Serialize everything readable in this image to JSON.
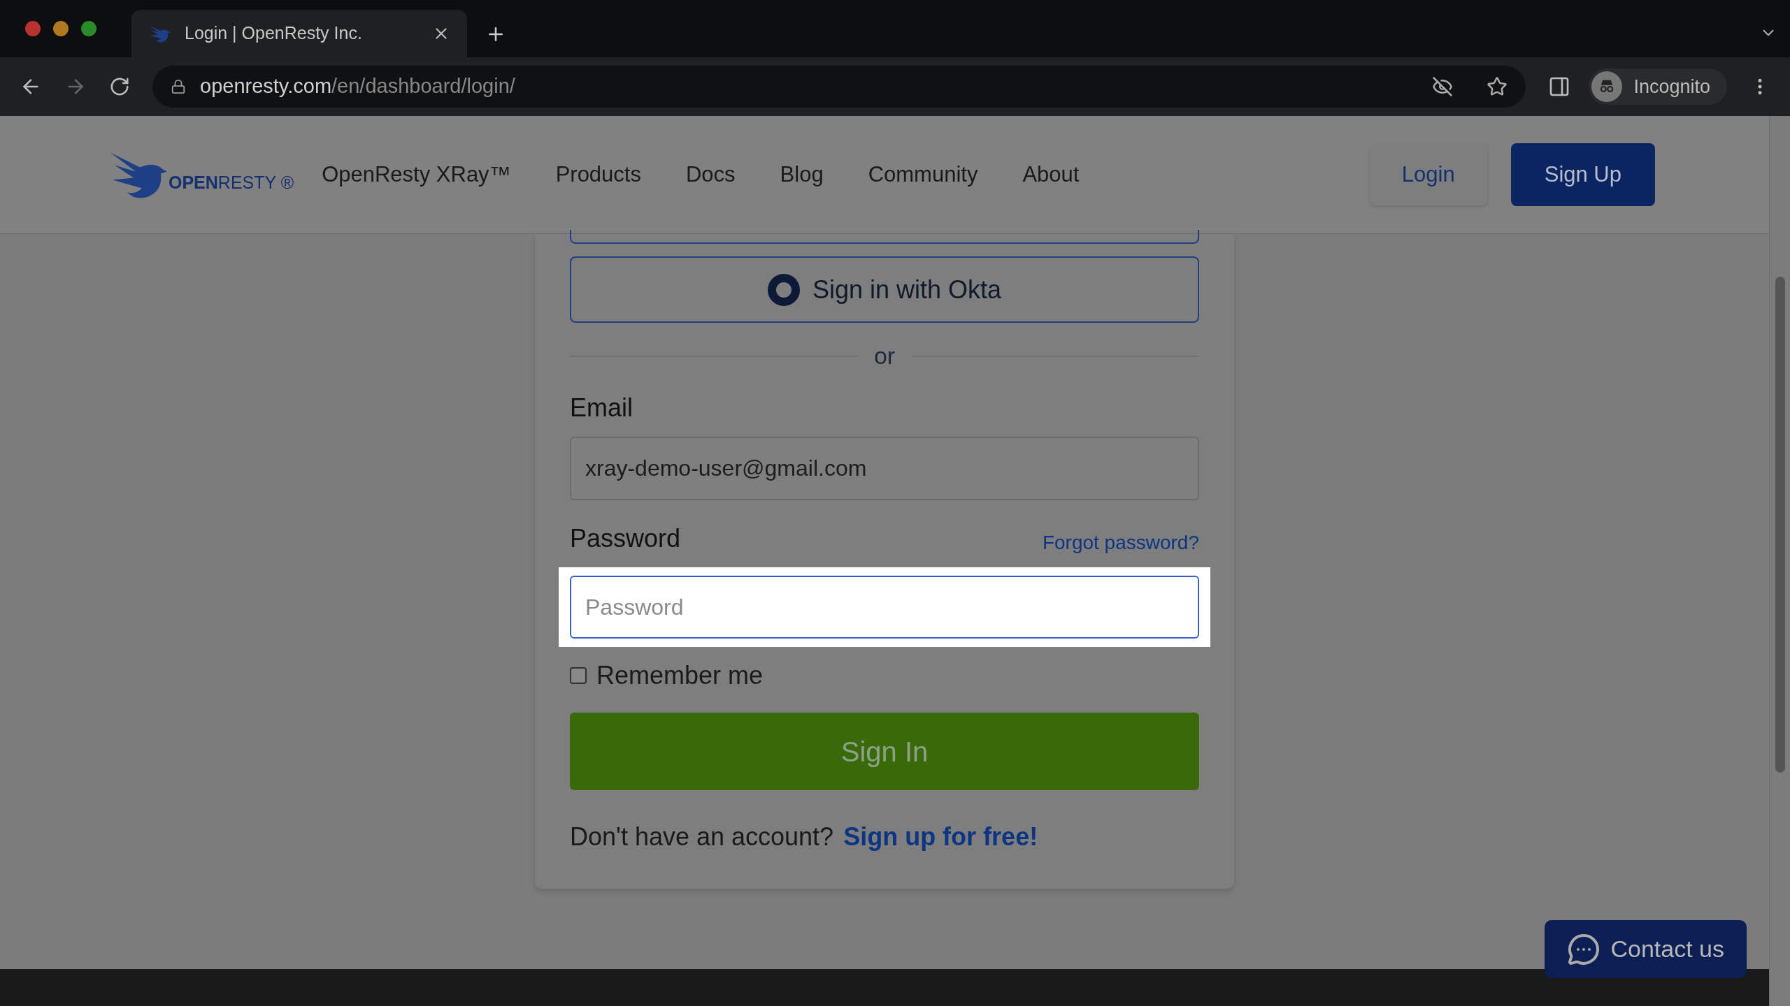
{
  "browser": {
    "tab": {
      "title": "Login | OpenResty Inc."
    },
    "url": {
      "host": "openresty.com",
      "path": "/en/dashboard/login/"
    },
    "profile": "Incognito"
  },
  "nav": {
    "logo": "**OPEN**RESTY ®",
    "items": [
      "OpenResty XRay™",
      "Products",
      "Docs",
      "Blog",
      "Community",
      "About"
    ],
    "login": "Login",
    "signup": "Sign Up"
  },
  "form": {
    "okta": "Sign in with Okta",
    "divider": "or",
    "email_label": "Email",
    "email_value": "xray-demo-user@gmail.com",
    "password_label": "Password",
    "forgot": "Forgot password?",
    "password_placeholder": "Password",
    "remember": {
      "label": "Remember me",
      "checked": false
    },
    "submit": "Sign In",
    "signup_prompt": "Don't have an account?",
    "signup_link": "Sign up for free!"
  },
  "contact": "Contact us"
}
